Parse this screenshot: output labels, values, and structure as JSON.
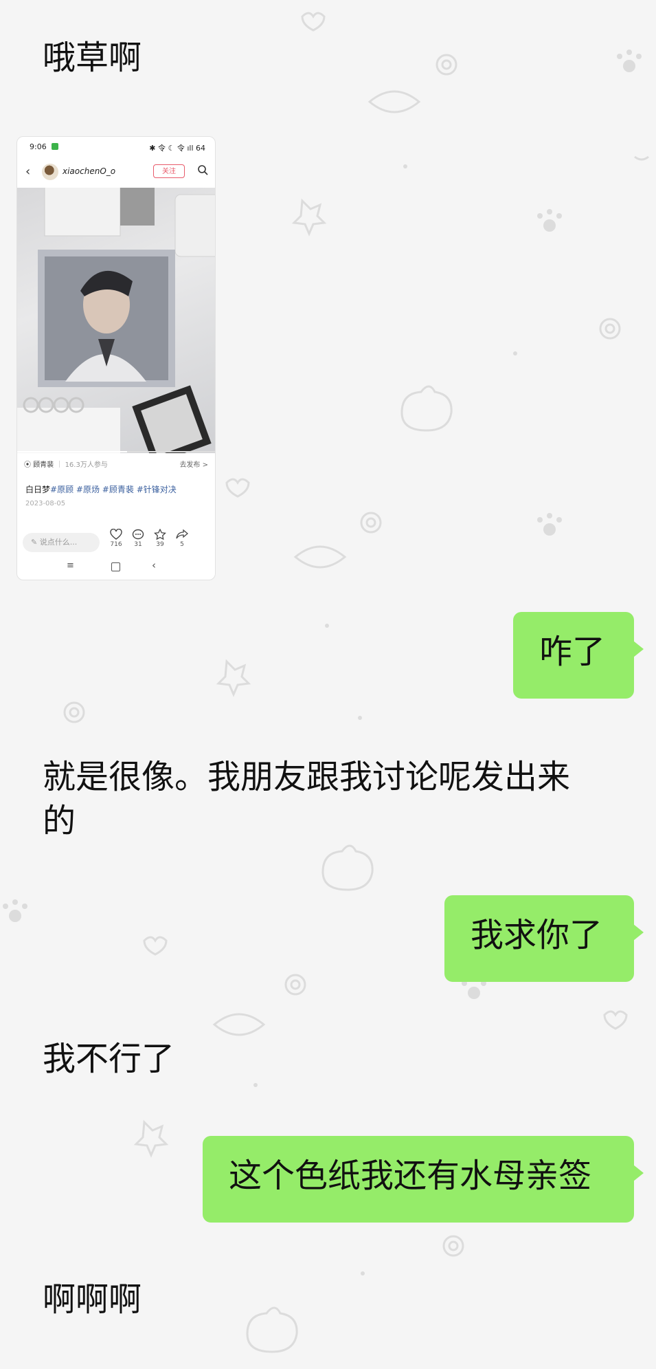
{
  "messages": {
    "m1": "哦草啊",
    "m2": "咋了",
    "m3_line1": "就是很像。我朋友跟我讨论呢发出来",
    "m3_line2": "的",
    "m4": "我求你了",
    "m5": "我不行了",
    "m6": "这个色纸我还有水母亲签",
    "m7": "啊啊啊"
  },
  "shared_screenshot": {
    "status_time": "9:06",
    "status_icons": "✱ 令 ☾ 令 ıll 64",
    "username": "xiaochenO_o",
    "follow_label": "关注",
    "topic_name": "顾青裴",
    "topic_count": "16.3万人参与",
    "topic_link": "去发布 >",
    "caption_prefix": "白日梦",
    "tags": [
      "#原顾",
      "#原炀",
      "#顾青裴",
      "#针锋对决"
    ],
    "date": "2023-08-05",
    "comment_placeholder": "说点什么...",
    "likes": "716",
    "comments": "31",
    "stars": "39",
    "shares": "5"
  },
  "colors": {
    "bubble_green": "#95ec69",
    "background": "#f5f5f5",
    "follow_red": "#e85a6a",
    "tag_blue": "#3a5f9e"
  }
}
